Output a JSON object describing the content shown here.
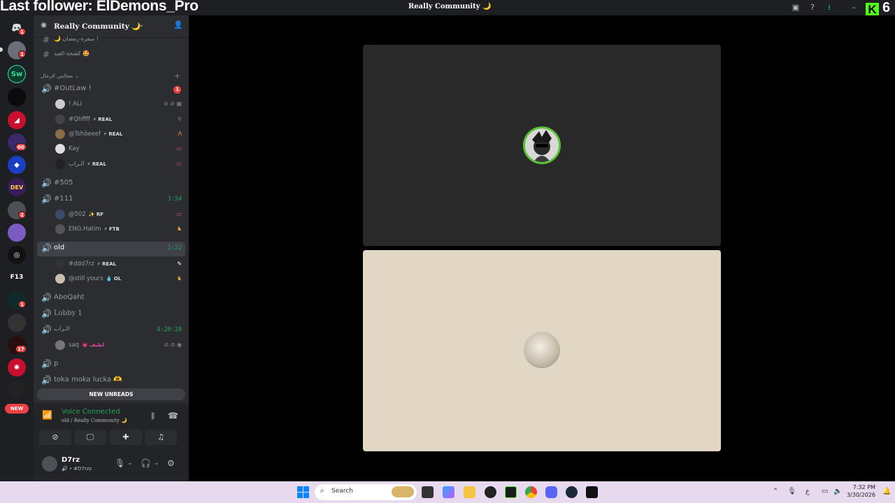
{
  "overlay": {
    "follower_text": "Last follower: ElDemons_Pro",
    "kick_count": "6",
    "kick_logo": "K"
  },
  "titlebar": {
    "title": "Really Community 🌙"
  },
  "rail": {
    "badges": [
      "1",
      "1",
      "60",
      "2",
      "1",
      "17"
    ],
    "labels": [
      "Sw",
      "DEV",
      "F13"
    ],
    "new_label": "NEW"
  },
  "sidebar": {
    "server_name": "Really Community 🌙",
    "top_channels": [
      {
        "name": "🌙 سفرة-رمضان !"
      },
      {
        "name": "كشخة-العيد 🤩"
      }
    ],
    "category": "مجالس الرجال",
    "voice": {
      "outlaw": {
        "name": "#OutLaw !",
        "badge": "1"
      },
      "outlaw_users": [
        {
          "name": "! ALI",
          "tag": ""
        },
        {
          "name": "#Qhffff",
          "tag": "⚡ REAL"
        },
        {
          "name": "@Tshöeeef",
          "tag": "⚡ REAL"
        },
        {
          "name": "Kay",
          "tag": ""
        },
        {
          "name": "الـراب",
          "tag": "⚡ REAL"
        }
      ],
      "c505": {
        "name": "#505"
      },
      "c111": {
        "name": "#111",
        "time": "3:54"
      },
      "c111_users": [
        {
          "name": "@502",
          "tag": "✨ RF"
        },
        {
          "name": "ENG.Hatim",
          "tag": "⚡ FTB"
        }
      ],
      "old": {
        "name": "old",
        "time": "1:22"
      },
      "old_users": [
        {
          "name": "#ddd7rz",
          "tag": "⚡ REAL"
        },
        {
          "name": "@still yours",
          "tag": "💧 OL"
        }
      ],
      "aboqaht": {
        "name": "AboQaht"
      },
      "lobby": {
        "name": "Lobby 1"
      },
      "alrap": {
        "name": "الـراب",
        "time": "4:20:20"
      },
      "alrap_users": [
        {
          "name": "saq",
          "tag": "💗 لطيف"
        }
      ],
      "p": {
        "name": "p"
      },
      "toka": {
        "name": "toka moka lucka 🫶"
      }
    },
    "new_unreads": "NEW UNREADS"
  },
  "voice_panel": {
    "status": "Voice Connected",
    "channel": "old / Really Community 🌙"
  },
  "user_panel": {
    "name": "D7rz",
    "handle": "#D7rzz"
  },
  "taskbar": {
    "search_placeholder": "Search",
    "time": "7:32 PM",
    "date": "3/30/2026"
  },
  "colors": {
    "accent_green": "#23a559",
    "kick_green": "#53fc18",
    "badge_red": "#f23f43"
  }
}
